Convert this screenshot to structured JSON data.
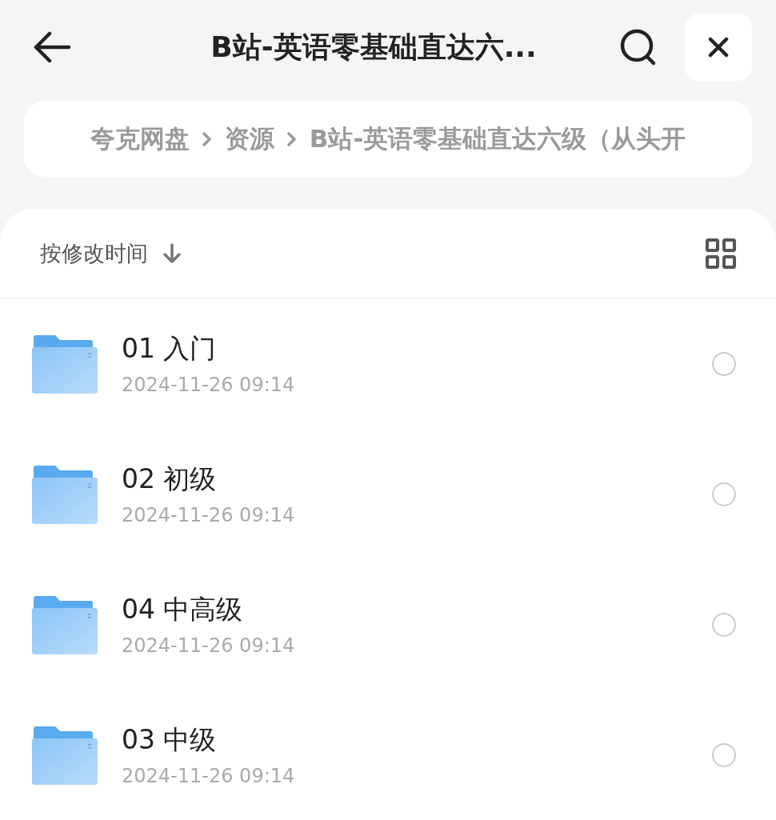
{
  "header": {
    "title": "B站-英语零基础直达六..."
  },
  "breadcrumb": [
    "夸克网盘",
    "资源",
    "B站-英语零基础直达六级（从头开"
  ],
  "sort": {
    "label": "按修改时间"
  },
  "files": [
    {
      "name": "01 入门",
      "date": "2024-11-26 09:14",
      "selected": false
    },
    {
      "name": "02 初级",
      "date": "2024-11-26 09:14",
      "selected": false
    },
    {
      "name": "04 中高级",
      "date": "2024-11-26 09:14",
      "selected": false
    },
    {
      "name": "03 中级",
      "date": "2024-11-26 09:14",
      "selected": false
    }
  ]
}
